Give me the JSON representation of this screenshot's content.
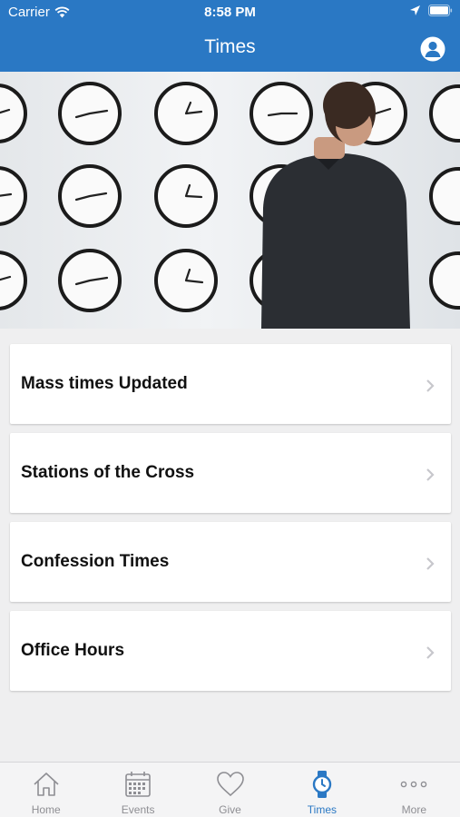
{
  "status_bar": {
    "carrier": "Carrier",
    "time": "8:58 PM"
  },
  "header": {
    "title": "Times"
  },
  "hero": {
    "image": "clocks-wall-man-photo"
  },
  "list": {
    "items": [
      {
        "label": "Mass times Updated"
      },
      {
        "label": "Stations of the Cross"
      },
      {
        "label": "Confession Times"
      },
      {
        "label": "Office Hours"
      }
    ]
  },
  "tabbar": {
    "tabs": [
      {
        "label": "Home",
        "icon": "home-icon"
      },
      {
        "label": "Events",
        "icon": "calendar-icon"
      },
      {
        "label": "Give",
        "icon": "heart-icon"
      },
      {
        "label": "Times",
        "icon": "watch-icon",
        "active": true
      },
      {
        "label": "More",
        "icon": "more-icon"
      }
    ]
  },
  "colors": {
    "brand": "#2a78c4",
    "inactive": "#8e8e93"
  }
}
